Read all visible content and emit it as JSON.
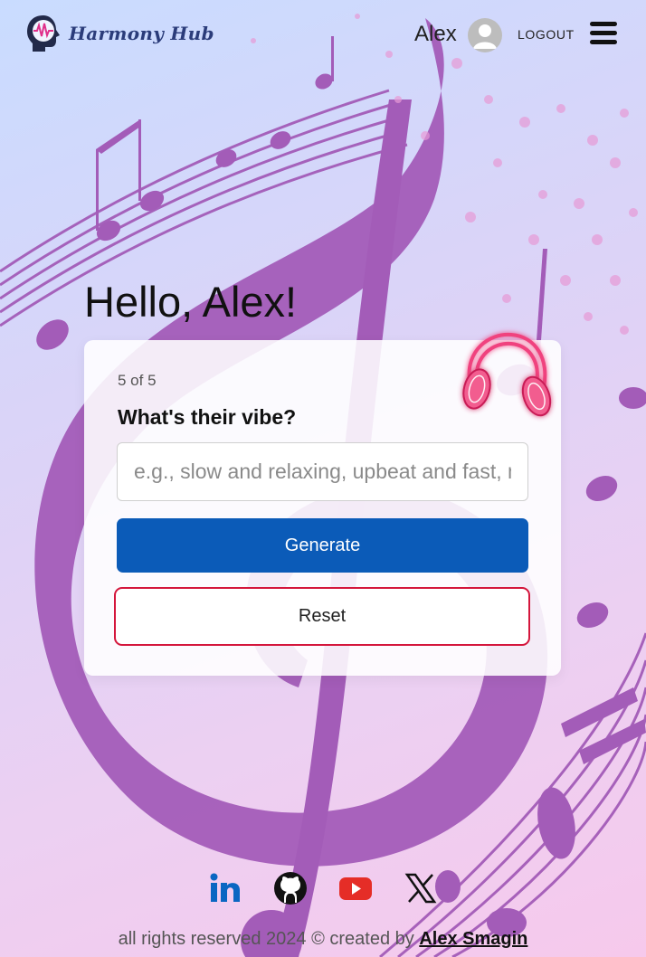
{
  "app": {
    "name": "Harmony Hub"
  },
  "header": {
    "user_name": "Alex",
    "logout_label": "LOGOUT"
  },
  "main": {
    "greeting": "Hello, Alex!",
    "step_indicator": "5 of 5",
    "question": "What's their vibe?",
    "input_placeholder": "e.g., slow and relaxing, upbeat and fast, mellow",
    "input_value": "",
    "generate_label": "Generate",
    "reset_label": "Reset"
  },
  "footer": {
    "social_links": [
      "linkedin-icon",
      "github-icon",
      "youtube-icon",
      "x-icon"
    ],
    "copyright_prefix": "all rights reserved 2024",
    "copyright_symbol": "©",
    "created_by": "created by",
    "author": "Alex Smagin"
  },
  "colors": {
    "primary_button": "#0b5bb8",
    "reset_border": "#d4163c",
    "background_art": "#a35cb8",
    "linkedin": "#0a66c2",
    "youtube": "#e52d27"
  }
}
